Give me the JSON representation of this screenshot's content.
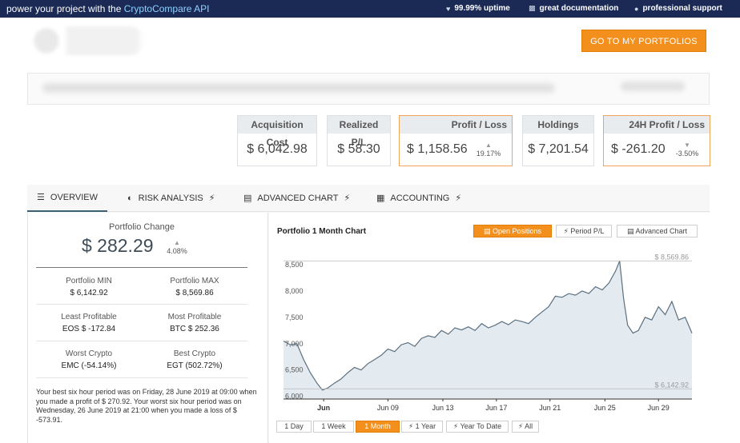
{
  "topbar": {
    "promo_prefix": "power your project with the ",
    "promo_api": "CryptoCompare API",
    "perks": [
      "99.99% uptime",
      "great documentation",
      "professional support"
    ]
  },
  "header": {
    "cta_label": "GO TO MY PORTFOLIOS"
  },
  "stats": {
    "acquisition_cost": {
      "label": "Acquisition Cost",
      "value": "$ 6,042.98"
    },
    "realized_pl": {
      "label": "Realized P/L",
      "value": "$ 58.30"
    },
    "profit_loss": {
      "label": "Profit / Loss",
      "value": "$ 1,158.56",
      "change": "19.17%"
    },
    "holdings": {
      "label": "Holdings",
      "value": "$ 7,201.54"
    },
    "h24_profit_loss": {
      "label": "24H Profit / Loss",
      "value": "$ -261.20",
      "change": "-3.50%"
    }
  },
  "tabs": [
    {
      "label": "OVERVIEW",
      "icon": "list-icon"
    },
    {
      "label": "RISK ANALYSIS",
      "icon": "pie-icon"
    },
    {
      "label": "ADVANCED CHART",
      "icon": "bar-chart-icon"
    },
    {
      "label": "ACCOUNTING",
      "icon": "calculator-icon"
    }
  ],
  "summary": {
    "change_label": "Portfolio Change",
    "change_value": "$ 282.29",
    "change_pct": "4.08%",
    "portfolio_min": {
      "label": "Portfolio MIN",
      "value": "$ 6,142.92"
    },
    "portfolio_max": {
      "label": "Portfolio MAX",
      "value": "$ 8,569.86"
    },
    "least_profitable": {
      "label": "Least Profitable",
      "value": "EOS $ -172.84"
    },
    "most_profitable": {
      "label": "Most Profitable",
      "value": "BTC $ 252.36"
    },
    "worst_crypto": {
      "label": "Worst Crypto",
      "value": "EMC (-54.14%)"
    },
    "best_crypto": {
      "label": "Best Crypto",
      "value": "EGT (502.72%)"
    },
    "note": "Your best six hour period was on Friday, 28 June 2019 at 09:00 when you made a profit of $ 270.92. Your worst six hour period was on Wednesday, 26 June 2019 at 21:00 when you made a loss of $ -573.91."
  },
  "chart": {
    "title": "Portfolio 1 Month Chart",
    "view_buttons": [
      "Open Positions",
      "Period P/L",
      "Advanced Chart"
    ],
    "range_buttons": [
      "1 Day",
      "1 Week",
      "1 Month",
      "1 Year",
      "Year To Date",
      "All"
    ],
    "active_range": "1 Month",
    "active_view": "Open Positions"
  },
  "chart_data": {
    "type": "area",
    "title": "Portfolio 1 Month Chart",
    "ylim": [
      5950,
      8650
    ],
    "yticks": [
      6000,
      6500,
      7000,
      7500,
      8000,
      8500
    ],
    "ytick_labels": [
      "6,000",
      "6,500",
      "7,000",
      "7,500",
      "8,000",
      "8,500"
    ],
    "xticks": [
      "Jun",
      "Jun 09",
      "Jun 13",
      "Jun 17",
      "Jun 21",
      "Jun 25",
      "Jun 29"
    ],
    "xtick_day": [
      4,
      8.8,
      12.9,
      16.9,
      20.9,
      25,
      29
    ],
    "x_range": [
      1,
      31.5
    ],
    "max_label": "$ 8,569.86",
    "min_label": "$ 6,142.92",
    "max_value": 8569.86,
    "min_value": 6142.92,
    "grid": false,
    "series": [
      {
        "x": [
          1,
          1.5,
          2,
          2.5,
          3,
          3.5,
          3.9,
          4.3,
          4.8,
          5.3,
          5.8,
          6.3,
          6.8,
          7.3,
          7.8,
          8.3,
          8.8,
          9.3,
          9.8,
          10.3,
          10.8,
          11.3,
          11.8,
          12.3,
          12.8,
          13.3,
          13.8,
          14.3,
          14.8,
          15.3,
          15.8,
          16.3,
          16.8,
          17.3,
          17.8,
          18.3,
          18.8,
          19.3,
          19.8,
          20.3,
          20.8,
          21.3,
          21.8,
          22.3,
          22.8,
          23.3,
          23.8,
          24.3,
          24.8,
          25.3,
          25.8,
          26.1,
          26.4,
          26.7,
          27.1,
          27.5,
          28,
          28.5,
          29,
          29.5,
          30,
          30.5,
          31,
          31.5
        ],
        "y": [
          7050,
          6980,
          7000,
          6700,
          6450,
          6250,
          6120,
          6160,
          6250,
          6330,
          6450,
          6550,
          6500,
          6620,
          6700,
          6780,
          6900,
          6850,
          6980,
          7020,
          6950,
          7100,
          7150,
          7120,
          7250,
          7180,
          7300,
          7260,
          7320,
          7250,
          7380,
          7300,
          7350,
          7420,
          7360,
          7450,
          7420,
          7380,
          7500,
          7600,
          7700,
          7900,
          7880,
          7950,
          7920,
          8000,
          7950,
          8080,
          8020,
          8150,
          8380,
          8570,
          7850,
          7350,
          7200,
          7250,
          7500,
          7450,
          7700,
          7550,
          7800,
          7450,
          7500,
          7200
        ]
      }
    ]
  }
}
